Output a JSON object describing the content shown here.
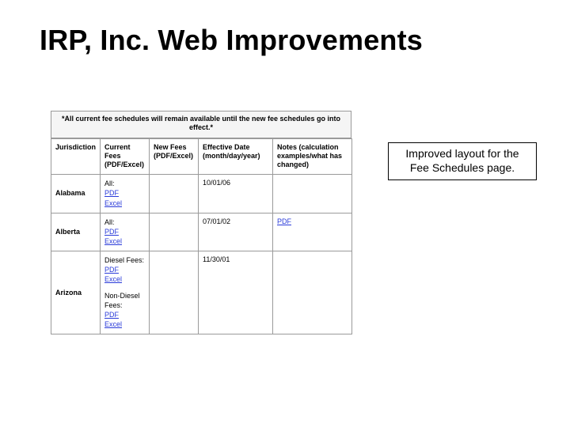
{
  "title": "IRP, Inc. Web Improvements",
  "notice": "*All current fee schedules will remain available until the new fee schedules go into effect.*",
  "headers": {
    "jurisdiction": "Jurisdiction",
    "current": "Current Fees (PDF/Excel)",
    "newfees": "New Fees (PDF/Excel)",
    "effective": "Effective Date (month/day/year)",
    "notes": "Notes (calculation examples/what has changed)"
  },
  "rows": [
    {
      "jurisdiction": "Alabama",
      "current": [
        {
          "label": "All:",
          "pdf": "PDF",
          "excel": "Excel"
        }
      ],
      "newfees": "",
      "effective": "10/01/06",
      "notes": ""
    },
    {
      "jurisdiction": "Alberta",
      "current": [
        {
          "label": "All:",
          "pdf": "PDF",
          "excel": "Excel"
        }
      ],
      "newfees": "",
      "effective": "07/01/02",
      "notes_link": "PDF"
    },
    {
      "jurisdiction": "Arizona",
      "current": [
        {
          "label": "Diesel Fees:",
          "pdf": "PDF",
          "excel": "Excel"
        },
        {
          "label": "Non-Diesel Fees:",
          "pdf": "PDF",
          "excel": "Excel"
        }
      ],
      "newfees": "",
      "effective": "11/30/01",
      "notes": ""
    }
  ],
  "callout": "Improved layout for the Fee Schedules page."
}
